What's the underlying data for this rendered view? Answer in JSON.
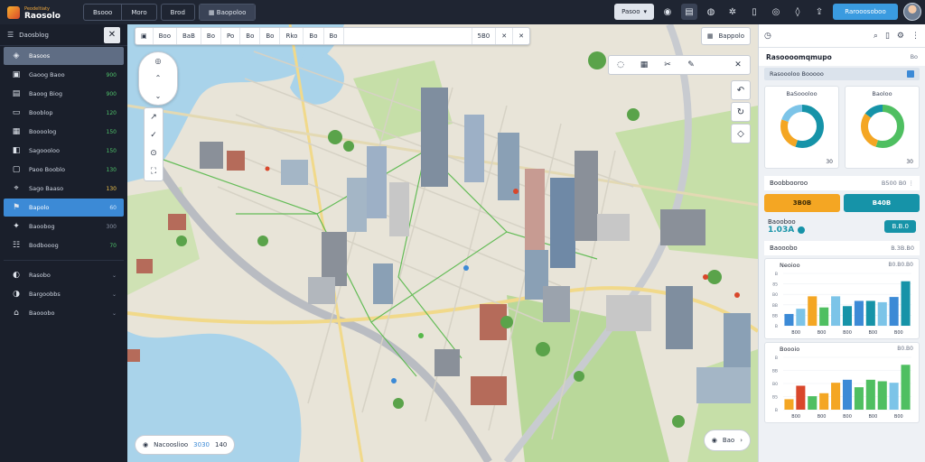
{
  "app": {
    "logo_small": "Peodeltiaty",
    "logo_main": "Raosolo"
  },
  "topbar": {
    "menu_a": "Bsooo",
    "menu_b": "Moro",
    "menu_c": "Brod",
    "menu_d": "Baopoloo",
    "pill_label": "Pasoo",
    "search_label": "Rarooosoboo",
    "icons": [
      "pill-caret-icon",
      "camera-icon",
      "grid-icon",
      "alert-icon",
      "settings-icon",
      "mobile-icon",
      "clock-icon",
      "drop-icon",
      "share-icon",
      "avatar"
    ]
  },
  "sidebar": {
    "header": "Daosblog",
    "items": [
      {
        "icon": "layers-icon",
        "label": "Basoos",
        "value": ""
      },
      {
        "icon": "map-icon",
        "label": "Gaoog Baoo",
        "value": "900"
      },
      {
        "icon": "folder-icon",
        "label": "Baoog Biog",
        "value": "900"
      },
      {
        "icon": "monitor-icon",
        "label": "Booblop",
        "value": "120"
      },
      {
        "icon": "message-icon",
        "label": "Boooolog",
        "value": "150"
      },
      {
        "icon": "chart-icon",
        "label": "Sagoooloo",
        "value": "150"
      },
      {
        "icon": "window-icon",
        "label": "Paoo Booblo",
        "value": "130"
      },
      {
        "icon": "pin-icon",
        "label": "Sago Baaso",
        "value": "130"
      },
      {
        "icon": "flag-icon",
        "label": "Bapolo",
        "value": "60"
      },
      {
        "icon": "star-icon",
        "label": "Baoobog",
        "value": "300"
      },
      {
        "icon": "list-icon",
        "label": "Bodbooog",
        "value": "70"
      },
      {
        "icon": "cloud-icon",
        "label": "Rasobo",
        "value": ""
      },
      {
        "icon": "building-icon",
        "label": "Bargoobbs",
        "value": ""
      },
      {
        "icon": "home-icon",
        "label": "Baooobo",
        "value": ""
      }
    ]
  },
  "map": {
    "toolbar": [
      "Boo",
      "BaB",
      "Bo",
      "Po",
      "Bo",
      "Bo",
      "Rko",
      "Bo",
      "Bo"
    ],
    "toolbar_value": "5B0",
    "toolbar_corner": "Bappolo",
    "draw_tools": [
      "lasso-icon",
      "select-box-icon",
      "scissors-icon",
      "pencil-icon",
      "separator",
      "close-icon"
    ],
    "right_tools": [
      "undo-icon",
      "redo-icon",
      "ruler-icon"
    ],
    "nav": [
      "compass-icon",
      "up-icon",
      "left-icon",
      "down-icon"
    ],
    "left_tools": [
      "draw-line-icon",
      "edit-icon",
      "layers-icon",
      "expand-icon"
    ],
    "status_label": "Nacooslioo",
    "status_value": "3030",
    "status_extra": "140",
    "zoom_label": "Bao"
  },
  "panel": {
    "title": "Rasoooomqmupo",
    "title_extra": "Bo",
    "filter_label": "Rasoooloo",
    "filter_right": "Booooo",
    "donut_a": {
      "title": "BaSoooloo",
      "value": "30"
    },
    "donut_b": {
      "title": "Baoloo",
      "value": "30"
    },
    "section_a": "Boobbooroo",
    "section_a_meta": "B500 B0",
    "kpi_a": "3B0B",
    "kpi_b": "B40B",
    "metric_label": "Baooboo",
    "metric_value": "1.03A",
    "metric_pill": "B.B.0",
    "section_b": "Baooobo",
    "section_b_meta": "B.3B.B0",
    "chart_a": {
      "title": "Neoioo",
      "right": "B0.B0.B0"
    },
    "chart_b": {
      "title": "Boooio",
      "right": "B0.B0"
    }
  },
  "chart_data": [
    {
      "type": "bar",
      "title": "Neoioo",
      "categories": [
        "B00",
        "B00",
        "B00",
        "B00",
        "B00"
      ],
      "yticks": [
        "B",
        "85",
        "B0",
        "BB",
        "BB",
        "B"
      ],
      "series": [
        {
          "values": [
            18,
            26,
            45,
            28,
            45,
            30,
            38,
            38,
            36,
            44,
            68
          ]
        }
      ],
      "colors": [
        "#3c8ad6",
        "#7cc4e8",
        "#f4a623",
        "#4fbf61",
        "#7cc4e8",
        "#1693a8",
        "#3c8ad6",
        "#1693a8",
        "#7cc4e8",
        "#3c8ad6",
        "#1693a8"
      ],
      "ylim": [
        0,
        80
      ]
    },
    {
      "type": "bar",
      "title": "Boooio",
      "categories": [
        "B00",
        "B00",
        "B00",
        "B00",
        "B00"
      ],
      "yticks": [
        "B",
        "BB",
        "B0",
        "B5",
        "B"
      ],
      "series": [
        {
          "values": [
            14,
            32,
            18,
            22,
            36,
            40,
            30,
            40,
            38,
            36,
            60
          ]
        }
      ],
      "colors": [
        "#f4a623",
        "#d9472b",
        "#4fbf61",
        "#f4a623",
        "#f4a623",
        "#3c8ad6",
        "#4fbf61",
        "#4fbf61",
        "#4fbf61",
        "#7cc4e8",
        "#4fbf61"
      ],
      "ylim": [
        0,
        70
      ]
    }
  ],
  "donuts": [
    {
      "slices": [
        0.55,
        0.25,
        0.2
      ],
      "colors": [
        "#1693a8",
        "#f4a623",
        "#7cc4e8"
      ]
    },
    {
      "slices": [
        0.55,
        0.3,
        0.15
      ],
      "colors": [
        "#4fbf61",
        "#f4a623",
        "#1693a8"
      ]
    }
  ]
}
